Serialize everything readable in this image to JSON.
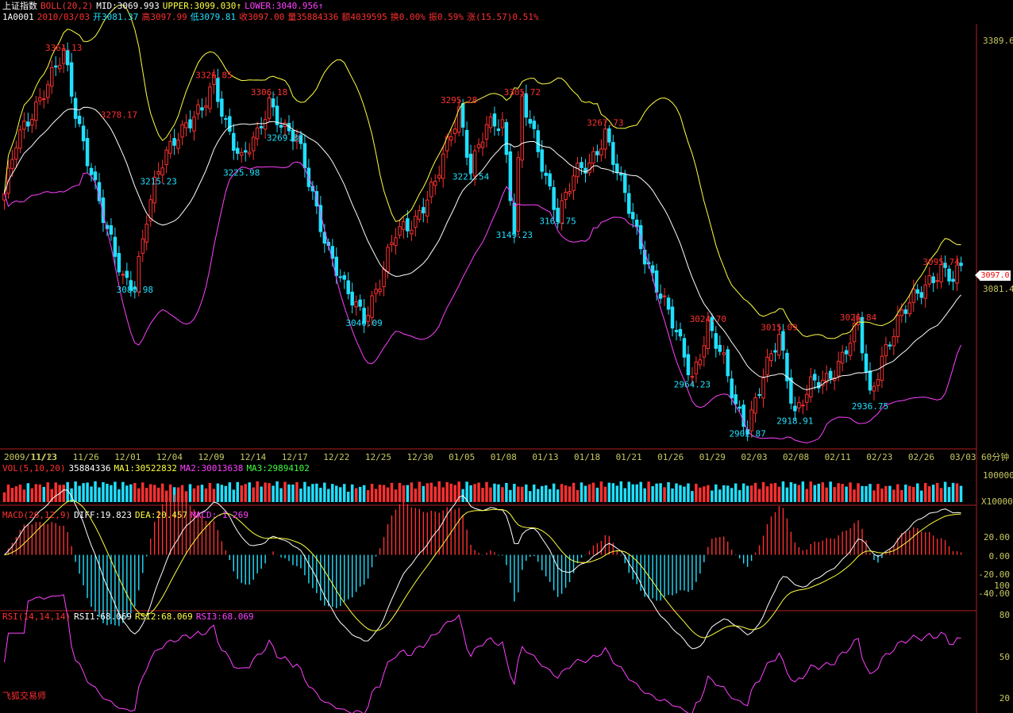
{
  "header": {
    "symbol_name": "上证指数",
    "indicator": "BOLL(20,2)",
    "mid": "MID:3069.993",
    "upper": "UPPER:3099.030",
    "lower": "LOWER:3040.956",
    "code": "1A0001",
    "date": "2010/03/03",
    "open": "开3081.37",
    "high": "高3097.99",
    "low": "低3079.81",
    "close": "收3097.00",
    "volume": "量35884336",
    "amount": "额4039595",
    "turnover": "换0.00%",
    "amplitude": "振0.59%",
    "change": "涨(15.57)0.51%"
  },
  "price_axis": {
    "top_label": "3389.6",
    "last_label": "3097.0",
    "ref_label": "3081.4"
  },
  "price_annotations": [
    {
      "text": "3361.13",
      "color": "#ff3030",
      "i": 15,
      "v": 3361
    },
    {
      "text": "3278.17",
      "color": "#ff3030",
      "i": 29,
      "v": 3278
    },
    {
      "text": "3080.98",
      "color": "#20e0ff",
      "i": 33,
      "v": 3081
    },
    {
      "text": "3215.23",
      "color": "#20e0ff",
      "i": 39,
      "v": 3215
    },
    {
      "text": "3326.85",
      "color": "#ff3030",
      "i": 53,
      "v": 3327
    },
    {
      "text": "3225.98",
      "color": "#20e0ff",
      "i": 60,
      "v": 3226
    },
    {
      "text": "3306.18",
      "color": "#ff3030",
      "i": 67,
      "v": 3306
    },
    {
      "text": "3269.37",
      "color": "#20e0ff",
      "i": 71,
      "v": 3269
    },
    {
      "text": "3040.09",
      "color": "#20e0ff",
      "i": 91,
      "v": 3040
    },
    {
      "text": "3295.28",
      "color": "#ff3030",
      "i": 115,
      "v": 3296
    },
    {
      "text": "3221.54",
      "color": "#20e0ff",
      "i": 118,
      "v": 3221
    },
    {
      "text": "3305.72",
      "color": "#ff3030",
      "i": 131,
      "v": 3306
    },
    {
      "text": "3149.23",
      "color": "#20e0ff",
      "i": 129,
      "v": 3149
    },
    {
      "text": "3165.75",
      "color": "#20e0ff",
      "i": 140,
      "v": 3166
    },
    {
      "text": "3267.73",
      "color": "#ff3030",
      "i": 152,
      "v": 3268
    },
    {
      "text": "3024.70",
      "color": "#ff3030",
      "i": 178,
      "v": 3025
    },
    {
      "text": "2964.23",
      "color": "#20e0ff",
      "i": 174,
      "v": 2964
    },
    {
      "text": "2902.87",
      "color": "#20e0ff",
      "i": 188,
      "v": 2903
    },
    {
      "text": "3015.09",
      "color": "#ff3030",
      "i": 196,
      "v": 3015
    },
    {
      "text": "2918.91",
      "color": "#20e0ff",
      "i": 200,
      "v": 2919
    },
    {
      "text": "3026.84",
      "color": "#ff3030",
      "i": 216,
      "v": 3027
    },
    {
      "text": "2936.75",
      "color": "#20e0ff",
      "i": 219,
      "v": 2937
    },
    {
      "text": "3095.74",
      "color": "#ff3030",
      "i": 237,
      "v": 3096
    }
  ],
  "date_axis": [
    "2009/11/13",
    "11/23",
    "11/26",
    "12/01",
    "12/04",
    "12/09",
    "12/14",
    "12/17",
    "12/22",
    "12/25",
    "12/30",
    "01/05",
    "01/08",
    "01/13",
    "01/18",
    "01/21",
    "01/26",
    "01/29",
    "02/03",
    "02/08",
    "02/11",
    "02/23",
    "02/26",
    "03/03"
  ],
  "period_label": "60分钟",
  "volume_panel": {
    "title": "VOL(5,10,20)",
    "value": "35884336",
    "ma1": "MA1:30522832",
    "ma2": "MA2:30013638",
    "ma3": "MA3:29894102",
    "axis_top": "100000",
    "axis_unit": "X10000"
  },
  "macd_panel": {
    "title": "MACD(26,12,9)",
    "diff": "DIFF:19.823",
    "dea": "DEA:20.457",
    "macd": "MACD:-1.269",
    "axis_labels": [
      "20.00",
      "0.00",
      "-20.00",
      "100",
      "-40.00"
    ]
  },
  "rsi_panel": {
    "title": "RSI(14,14,14)",
    "rsi1": "RSI1:68.069",
    "rsi2": "RSI2:68.069",
    "rsi3": "RSI3:68.069",
    "axis_labels": [
      "80",
      "50",
      "20"
    ]
  },
  "arrows": {
    "up": "↑",
    "down": "↓"
  },
  "footer_brand": "飞狐交易师",
  "colors": {
    "background": "#000000",
    "up": "#ff3030",
    "down": "#20e0ff",
    "mid_band": "#ffffff",
    "upper_band": "#ffff40",
    "lower_band": "#ff40ff",
    "axis": "#b02020",
    "axis_text": "#c8c860"
  },
  "chart_data": {
    "type": "line",
    "title": "上证指数 BOLL(20,2)",
    "price_anchors": [
      [
        0,
        3190
      ],
      [
        3,
        3250
      ],
      [
        7,
        3290
      ],
      [
        10,
        3320
      ],
      [
        15,
        3361
      ],
      [
        18,
        3290
      ],
      [
        22,
        3220
      ],
      [
        26,
        3140
      ],
      [
        30,
        3085
      ],
      [
        33,
        3081
      ],
      [
        36,
        3160
      ],
      [
        39,
        3215
      ],
      [
        43,
        3260
      ],
      [
        46,
        3278
      ],
      [
        50,
        3290
      ],
      [
        53,
        3327
      ],
      [
        56,
        3280
      ],
      [
        60,
        3230
      ],
      [
        64,
        3260
      ],
      [
        67,
        3306
      ],
      [
        71,
        3269
      ],
      [
        74,
        3255
      ],
      [
        78,
        3190
      ],
      [
        82,
        3120
      ],
      [
        86,
        3070
      ],
      [
        91,
        3040
      ],
      [
        95,
        3080
      ],
      [
        99,
        3140
      ],
      [
        104,
        3160
      ],
      [
        109,
        3200
      ],
      [
        112,
        3250
      ],
      [
        115,
        3296
      ],
      [
        118,
        3221
      ],
      [
        122,
        3270
      ],
      [
        126,
        3280
      ],
      [
        129,
        3149
      ],
      [
        131,
        3306
      ],
      [
        135,
        3240
      ],
      [
        140,
        3166
      ],
      [
        144,
        3210
      ],
      [
        148,
        3225
      ],
      [
        152,
        3268
      ],
      [
        156,
        3200
      ],
      [
        160,
        3140
      ],
      [
        164,
        3090
      ],
      [
        168,
        3040
      ],
      [
        172,
        2990
      ],
      [
        174,
        2964
      ],
      [
        178,
        3025
      ],
      [
        182,
        2980
      ],
      [
        185,
        2930
      ],
      [
        188,
        2903
      ],
      [
        192,
        2960
      ],
      [
        196,
        3015
      ],
      [
        200,
        2919
      ],
      [
        204,
        2950
      ],
      [
        208,
        2960
      ],
      [
        212,
        2990
      ],
      [
        216,
        3027
      ],
      [
        219,
        2937
      ],
      [
        222,
        2990
      ],
      [
        226,
        3030
      ],
      [
        230,
        3060
      ],
      [
        234,
        3085
      ],
      [
        237,
        3096
      ],
      [
        240,
        3080
      ],
      [
        242,
        3097
      ]
    ],
    "price_range": [
      2880,
      3400
    ],
    "volume_range": [
      0,
      100000
    ],
    "macd_range": [
      -55,
      35
    ],
    "rsi_range": [
      20,
      80
    ],
    "bar_count": 243,
    "series": [
      {
        "name": "MID"
      },
      {
        "name": "UPPER"
      },
      {
        "name": "LOWER"
      },
      {
        "name": "DIFF"
      },
      {
        "name": "DEA"
      },
      {
        "name": "MACD"
      },
      {
        "name": "RSI1"
      }
    ]
  }
}
